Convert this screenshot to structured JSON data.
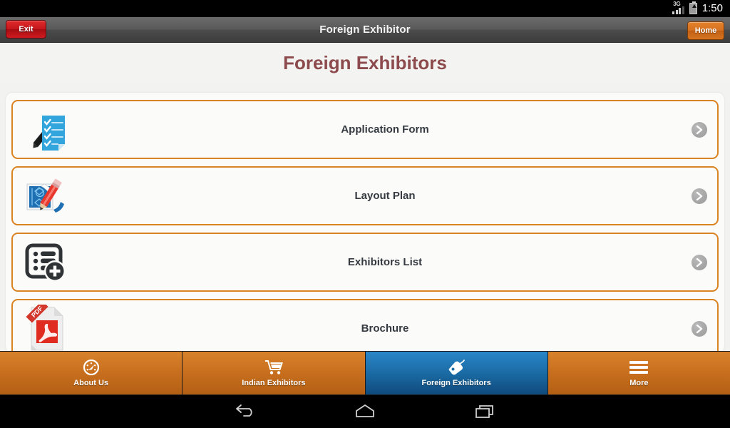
{
  "status_bar": {
    "network_label": "3G",
    "network_icon": "signal-bars-icon",
    "battery_icon": "battery-charging-icon",
    "clock": "1:50"
  },
  "title_bar": {
    "exit_label": "Exit",
    "title": "Foreign Exhibitor",
    "home_label": "Home"
  },
  "page": {
    "heading": "Foreign Exhibitors",
    "heading_color": "#8d4a4c",
    "accent_color": "#da8322"
  },
  "list": {
    "items": [
      {
        "label": "Application Form",
        "icon": "checklist-form-icon",
        "chevron": "chevron-right-icon"
      },
      {
        "label": "Layout Plan",
        "icon": "blueprint-pencil-icon",
        "chevron": "chevron-right-icon"
      },
      {
        "label": "Exhibitors List",
        "icon": "list-add-icon",
        "chevron": "chevron-right-icon"
      },
      {
        "label": "Brochure",
        "icon": "pdf-document-icon",
        "chevron": "chevron-right-icon"
      }
    ]
  },
  "tabbar": {
    "active_color": "#1c6ea8",
    "inactive_color": "#c9701f",
    "tabs": [
      {
        "label": "About Us",
        "icon": "speedometer-icon",
        "active": false
      },
      {
        "label": "Indian Exhibitors",
        "icon": "shopping-cart-icon",
        "active": false
      },
      {
        "label": "Foreign Exhibitors",
        "icon": "price-tag-icon",
        "active": true
      },
      {
        "label": "More",
        "icon": "hamburger-menu-icon",
        "active": false
      }
    ]
  },
  "nav_bar": {
    "back": "back-icon",
    "home": "home-icon",
    "recents": "recents-icon"
  }
}
